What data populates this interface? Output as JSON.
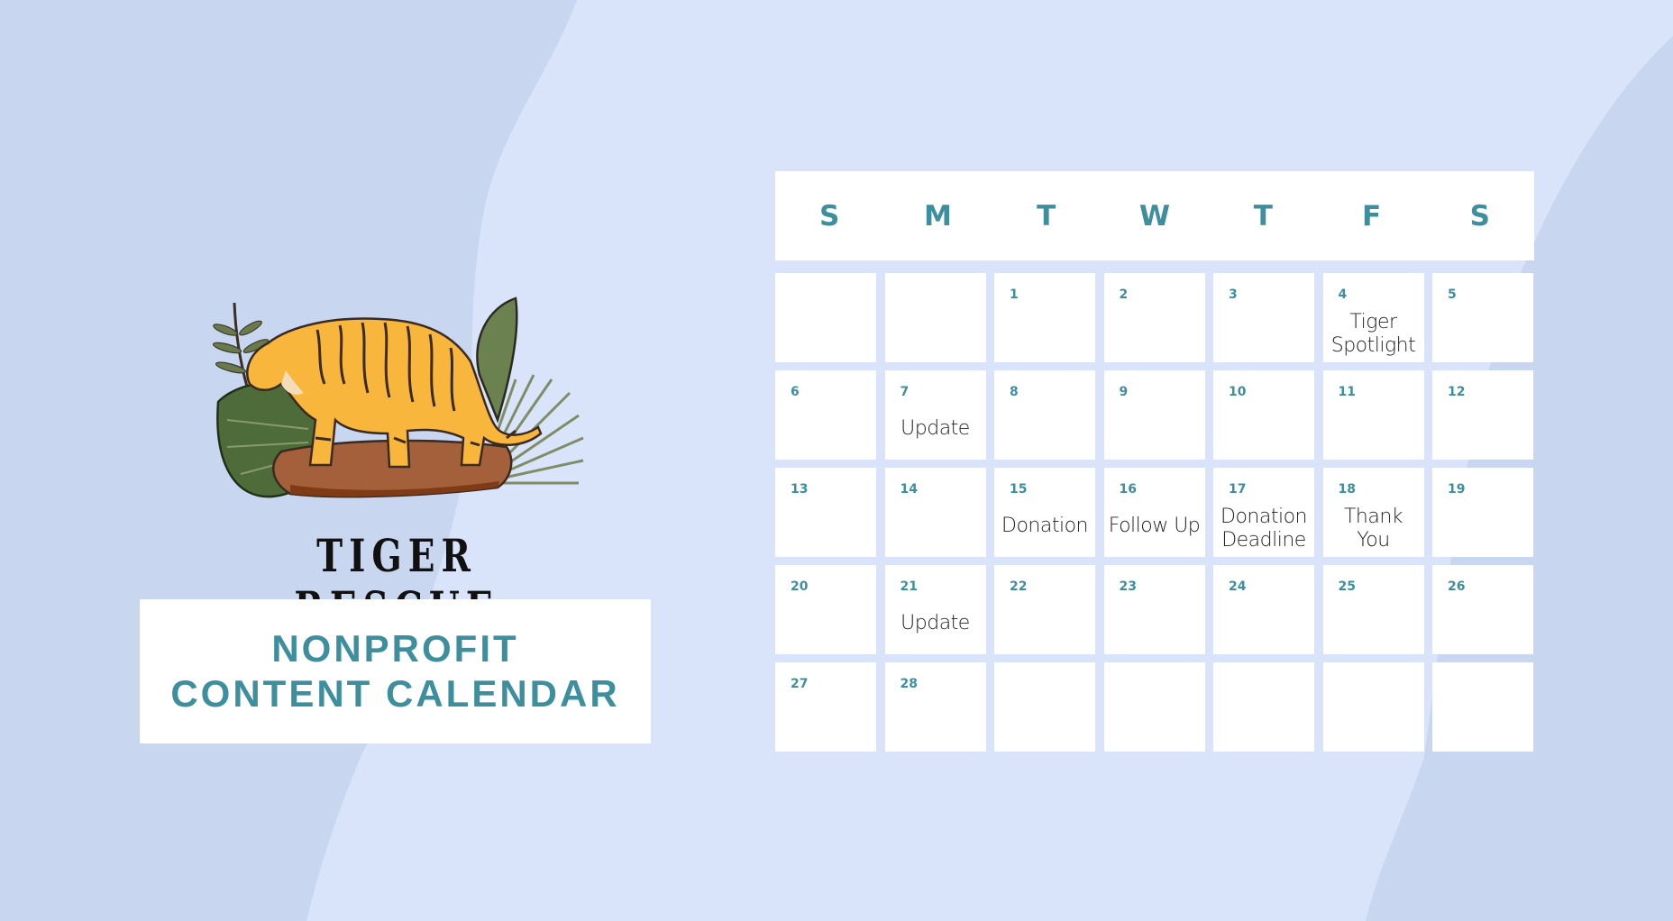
{
  "colors": {
    "background_light": "#d9e4fb",
    "background_dark": "#c9d6f0",
    "accent_teal": "#3d8f9e",
    "cell_white": "#ffffff"
  },
  "brand": {
    "logo_icon": "tiger-on-rock-with-tropical-leaves",
    "name": "TIGER RESCUE"
  },
  "title": {
    "line1": "NONPROFIT",
    "line2": "CONTENT CALENDAR"
  },
  "calendar": {
    "weekdays": [
      "S",
      "M",
      "T",
      "W",
      "T",
      "F",
      "S"
    ],
    "cells": [
      {
        "day": "",
        "events": []
      },
      {
        "day": "",
        "events": []
      },
      {
        "day": "1",
        "events": []
      },
      {
        "day": "2",
        "events": []
      },
      {
        "day": "3",
        "events": []
      },
      {
        "day": "4",
        "events": [
          "Tiger",
          "Spotlight"
        ]
      },
      {
        "day": "5",
        "events": []
      },
      {
        "day": "6",
        "events": []
      },
      {
        "day": "7",
        "events": [
          "Update"
        ]
      },
      {
        "day": "8",
        "events": []
      },
      {
        "day": "9",
        "events": []
      },
      {
        "day": "10",
        "events": []
      },
      {
        "day": "11",
        "events": []
      },
      {
        "day": "12",
        "events": []
      },
      {
        "day": "13",
        "events": []
      },
      {
        "day": "14",
        "events": []
      },
      {
        "day": "15",
        "events": [
          "Donation"
        ]
      },
      {
        "day": "16",
        "events": [
          "Follow Up"
        ]
      },
      {
        "day": "17",
        "events": [
          "Donation",
          "Deadline"
        ]
      },
      {
        "day": "18",
        "events": [
          "Thank",
          "You"
        ]
      },
      {
        "day": "19",
        "events": []
      },
      {
        "day": "20",
        "events": []
      },
      {
        "day": "21",
        "events": [
          "Update"
        ]
      },
      {
        "day": "22",
        "events": []
      },
      {
        "day": "23",
        "events": []
      },
      {
        "day": "24",
        "events": []
      },
      {
        "day": "25",
        "events": []
      },
      {
        "day": "26",
        "events": []
      },
      {
        "day": "27",
        "events": []
      },
      {
        "day": "28",
        "events": []
      },
      {
        "day": "",
        "events": []
      },
      {
        "day": "",
        "events": []
      },
      {
        "day": "",
        "events": []
      },
      {
        "day": "",
        "events": []
      },
      {
        "day": "",
        "events": []
      }
    ]
  }
}
